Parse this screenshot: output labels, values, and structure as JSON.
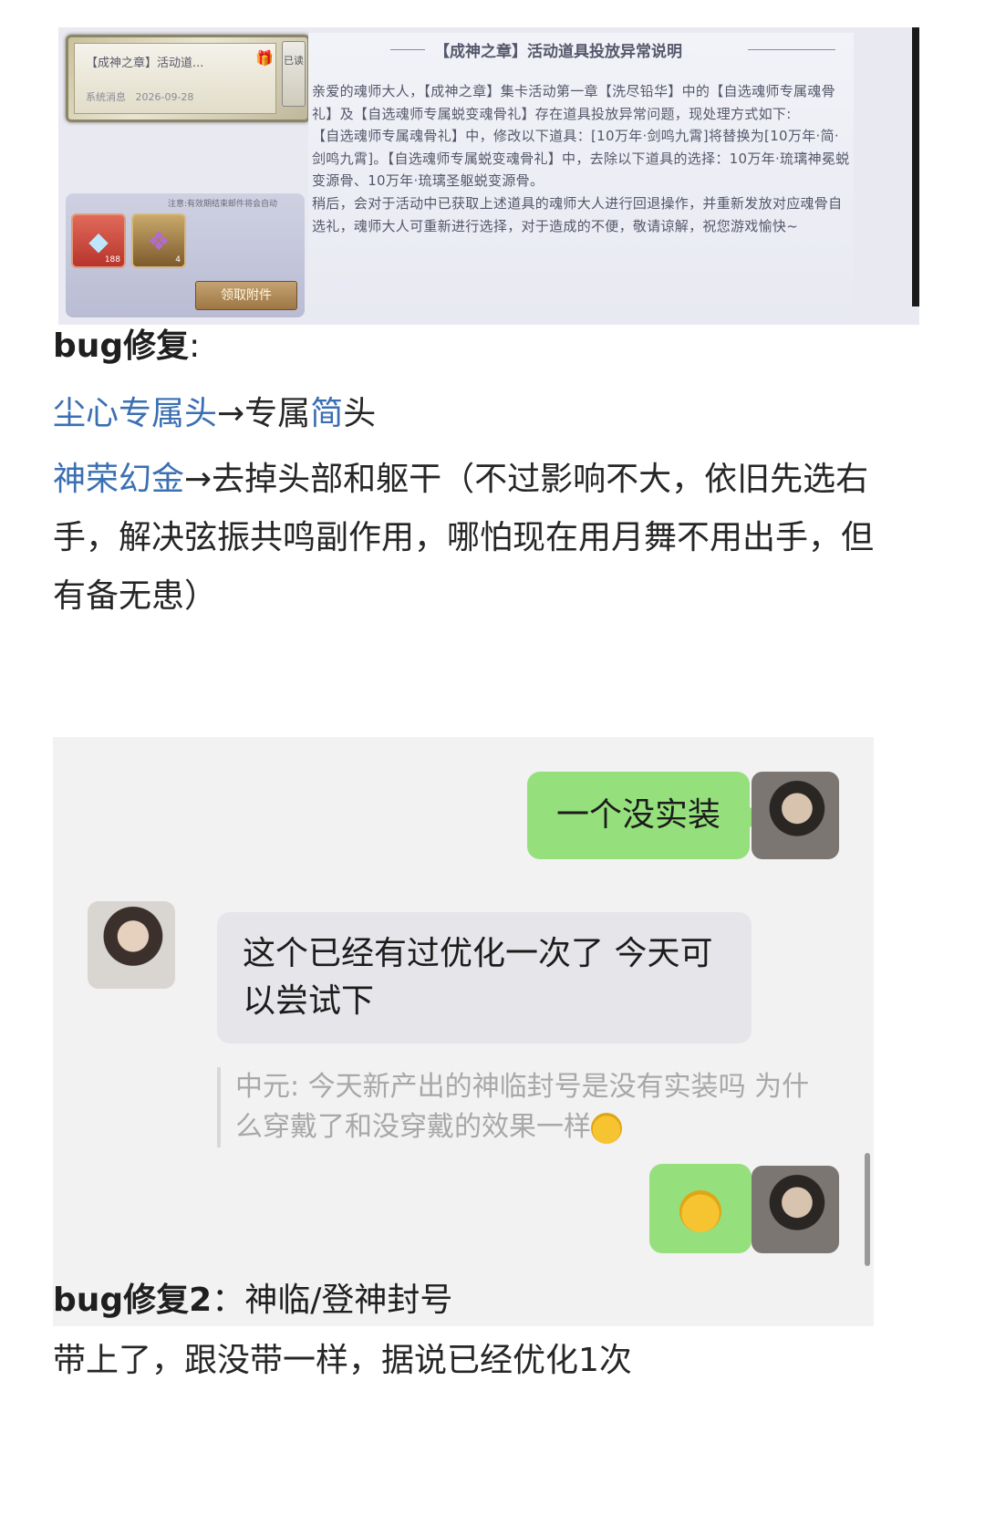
{
  "mail": {
    "list_title": "【成神之章】活动道...",
    "list_sender": "系统消息",
    "list_date": "2026-09-28",
    "read_tag": "已读",
    "attach_note": "注意:有效期结束邮件将会自动",
    "items": [
      {
        "icon": "diamond-icon",
        "count": "188"
      },
      {
        "icon": "skill-scroll-icon",
        "count": "4"
      }
    ],
    "claim_label": "领取附件",
    "body_title": "【成神之章】活动道具投放异常说明",
    "body_paragraphs": [
      "亲爱的魂师大人，【成神之章】集卡活动第一章【洗尽铅华】中的【自选魂师专属魂骨礼】及【自选魂师专属蜕变魂骨礼】存在道具投放异常问题，现处理方式如下:",
      "【自选魂师专属魂骨礼】中，修改以下道具：[10万年·剑鸣九霄]将替换为[10万年·简·剑鸣九霄]。【自选魂师专属蜕变魂骨礼】中，去除以下道具的选择：10万年·琉璃神冕蜕变源骨、10万年·琉璃圣躯蜕变源骨。",
      "稍后，会对于活动中已获取上述道具的魂师大人进行回退操作，并重新发放对应魂骨自选礼，魂师大人可重新进行选择，对于造成的不便，敬请谅解，祝您游戏愉快~"
    ]
  },
  "article": {
    "heading1": "bug修复",
    "heading1_colon": ":",
    "line1_hl": "尘心专属头",
    "line1_mid": "→专属",
    "line1_hl2": "简",
    "line1_end": "头",
    "line2_hl": "神荣幻金",
    "line2_rest": "→去掉头部和躯干（不过影响不大，依旧先选右手，解决弦振共鸣副作用，哪怕现在用月舞不用出手，但有备无患）",
    "heading2": "bug修复2",
    "heading2_rest": "：神临/登神封号",
    "line3": "带上了，跟没带一样，据说已经优化1次"
  },
  "chat": {
    "msg1": "一个没实装",
    "msg2": "这个已经有过优化一次了 今天可以尝试下",
    "quote": "中元: 今天新产出的神临封号是没有实装吗 为什么穿戴了和没穿戴的效果一样",
    "msg3_emoji": "laughing-crying-emoji"
  }
}
